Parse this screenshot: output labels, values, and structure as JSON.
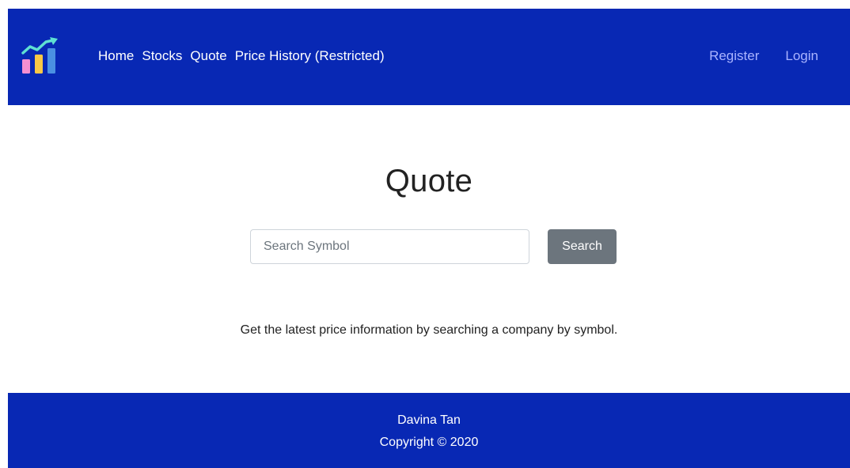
{
  "navbar": {
    "logo_icon": "rising-bar-chart-icon",
    "links": [
      "Home",
      "Stocks",
      "Quote",
      "Price History (Restricted)"
    ],
    "auth_links": [
      "Register",
      "Login"
    ],
    "background_color": "#0828b4",
    "auth_link_color": "#aab4ff"
  },
  "main": {
    "title": "Quote",
    "search": {
      "placeholder": "Search Symbol",
      "value": "",
      "button_label": "Search",
      "button_color": "#6c757d"
    },
    "info_text": "Get the latest price information by searching a company by symbol."
  },
  "footer": {
    "name": "Davina Tan",
    "copyright": "Copyright © 2020",
    "background_color": "#0828b4"
  }
}
